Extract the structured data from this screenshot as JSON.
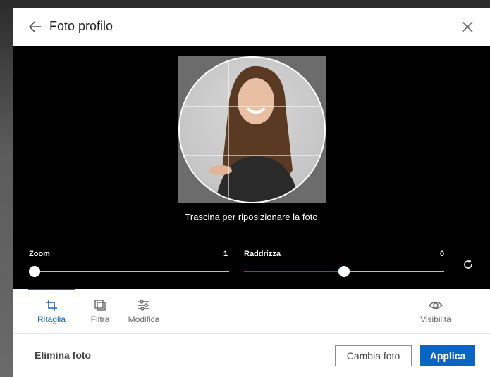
{
  "header": {
    "title": "Foto profilo",
    "back_icon": "arrow-left-icon",
    "close_icon": "close-icon"
  },
  "canvas": {
    "hint": "Trascina per riposizionare la foto"
  },
  "sliders": {
    "zoom": {
      "label": "Zoom",
      "value": "1",
      "level": 0.0
    },
    "straighten": {
      "label": "Raddrizza",
      "value": "0",
      "level": 0.5
    },
    "reset_icon": "rotate-reset-icon"
  },
  "tabs": [
    {
      "label": "Ritaglia",
      "icon": "crop-icon",
      "active": true
    },
    {
      "label": "Filtra",
      "icon": "filter-icon",
      "active": false
    },
    {
      "label": "Modifica",
      "icon": "adjust-icon",
      "active": false
    },
    {
      "label": "Visibilità",
      "icon": "eye-icon",
      "active": false
    }
  ],
  "footer": {
    "delete_label": "Elimina foto",
    "change_label": "Cambia foto",
    "apply_label": "Applica"
  },
  "colors": {
    "accent": "#0a66c2",
    "canvas_bg": "#000000"
  }
}
